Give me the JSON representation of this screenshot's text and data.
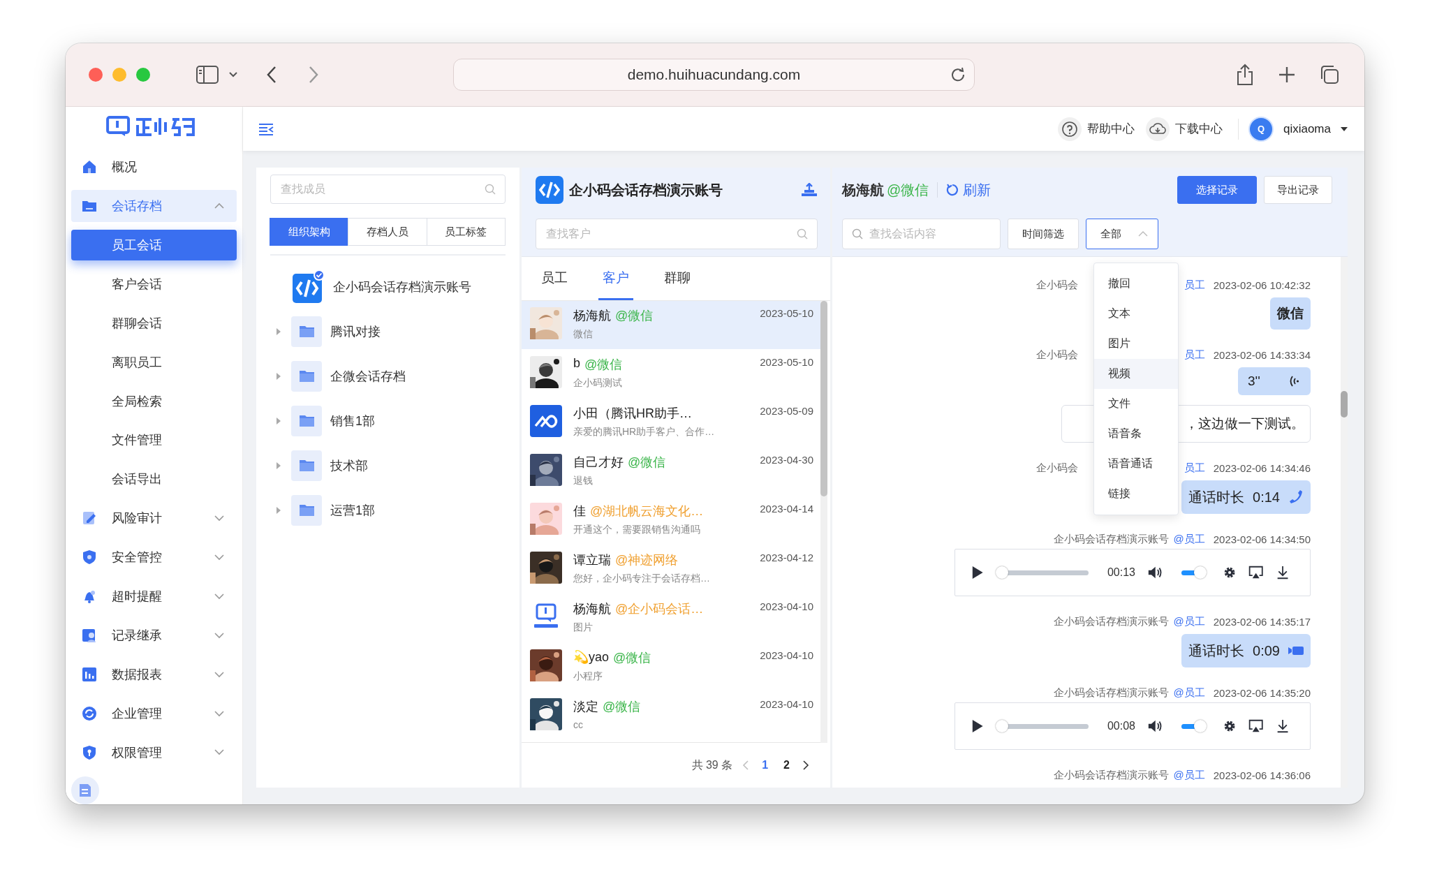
{
  "browser": {
    "url": "demo.huihuacundang.com"
  },
  "sidebar": {
    "items": [
      {
        "label": "概况",
        "kind": "link",
        "selected": false
      },
      {
        "label": "会话存档",
        "kind": "group",
        "expanded": true,
        "selected": true,
        "children": [
          {
            "label": "员工会话",
            "selected": true
          },
          {
            "label": "客户会话",
            "selected": false
          },
          {
            "label": "群聊会话",
            "selected": false
          },
          {
            "label": "离职员工",
            "selected": false
          },
          {
            "label": "全局检索",
            "selected": false
          },
          {
            "label": "文件管理",
            "selected": false
          },
          {
            "label": "会话导出",
            "selected": false
          }
        ]
      },
      {
        "label": "风险审计",
        "kind": "group",
        "expanded": false,
        "selected": false
      },
      {
        "label": "安全管控",
        "kind": "group",
        "expanded": false,
        "selected": false
      },
      {
        "label": "超时提醒",
        "kind": "group",
        "expanded": false,
        "selected": false
      },
      {
        "label": "记录继承",
        "kind": "group",
        "expanded": false,
        "selected": false
      },
      {
        "label": "数据报表",
        "kind": "group",
        "expanded": false,
        "selected": false
      },
      {
        "label": "企业管理",
        "kind": "group",
        "expanded": false,
        "selected": false
      },
      {
        "label": "权限管理",
        "kind": "group",
        "expanded": false,
        "selected": false
      }
    ]
  },
  "header": {
    "help": "帮助中心",
    "download": "下载中心",
    "user": {
      "initial": "Q",
      "name": "qixiaoma"
    }
  },
  "members": {
    "search": {
      "placeholder": "查找成员"
    },
    "tabs": [
      {
        "label": "组织架构",
        "selected": true
      },
      {
        "label": "存档人员",
        "selected": false
      },
      {
        "label": "员工标签",
        "selected": false
      }
    ],
    "tree": [
      {
        "label": "企小码会话存档演示账号",
        "kind": "account"
      },
      {
        "label": "腾讯对接",
        "kind": "folder",
        "expanded": false
      },
      {
        "label": "企微会话存档",
        "kind": "folder",
        "expanded": false
      },
      {
        "label": "销售1部",
        "kind": "folder",
        "expanded": false
      },
      {
        "label": "技术部",
        "kind": "folder",
        "expanded": false
      },
      {
        "label": "运营1部",
        "kind": "folder",
        "expanded": false
      }
    ]
  },
  "customers": {
    "account": "企小码会话存档演示账号",
    "search": {
      "placeholder": "查找客户"
    },
    "tabs": [
      {
        "label": "员工",
        "selected": false
      },
      {
        "label": "客户",
        "selected": true
      },
      {
        "label": "群聊",
        "selected": false
      }
    ],
    "conversations": [
      {
        "name": "杨海航",
        "tag": "@微信",
        "color": "#3bb54a",
        "preview": "微信",
        "date": "2023-05-10",
        "selected": true
      },
      {
        "name": "b",
        "tag": "@微信",
        "color": "#3bb54a",
        "preview": "企小码测试",
        "date": "2023-05-10",
        "selected": false
      },
      {
        "name": "小田（腾讯HR助手…",
        "preview": "亲爱的腾讯HR助手客户、合作…",
        "date": "2023-05-09",
        "selected": false,
        "avatar": {
          "kind": "app-logo"
        }
      },
      {
        "name": "自己才好",
        "tag": "@微信",
        "color": "#3bb54a",
        "preview": "退钱",
        "date": "2023-04-30",
        "selected": false
      },
      {
        "name": "佳",
        "tag": "@湖北帆云海文化…",
        "color": "#f0a030",
        "preview": "开通这个，需要跟销售沟通吗",
        "date": "2023-04-14",
        "selected": false
      },
      {
        "name": "谭立瑞",
        "tag": "@神迹网络",
        "color": "#f0a030",
        "preview": "您好，企小码专注于会话存档…",
        "date": "2023-04-12",
        "selected": false
      },
      {
        "name": "杨海航",
        "tag": "@企小码会话…",
        "color": "#f0a030",
        "preview": "图片",
        "date": "2023-04-10",
        "selected": false,
        "avatar": {
          "kind": "brand-logo"
        }
      },
      {
        "name": "💫yao",
        "tag": "@微信",
        "color": "#3bb54a",
        "preview": "小程序",
        "date": "2023-04-10",
        "selected": false
      },
      {
        "name": "淡定",
        "tag": "@微信",
        "color": "#3bb54a",
        "preview": "cc",
        "date": "2023-04-10",
        "selected": false
      }
    ],
    "pagination": {
      "total": "共 39 条",
      "pages": [
        {
          "label": "1",
          "selected": true
        },
        {
          "label": "2",
          "selected": false
        }
      ]
    }
  },
  "chat": {
    "contact": {
      "name": "杨海航",
      "tag": "@微信"
    },
    "refresh": "刷新",
    "select_button": "选择记录",
    "export_button": "导出记录",
    "search": {
      "placeholder": "查找会话内容"
    },
    "time_filter": "时间筛选",
    "type_filter": {
      "value": "全部",
      "expanded": true,
      "options": [
        {
          "label": "撤回",
          "highlighted": false
        },
        {
          "label": "文本",
          "highlighted": false
        },
        {
          "label": "图片",
          "highlighted": false
        },
        {
          "label": "视频",
          "highlighted": true
        },
        {
          "label": "文件",
          "highlighted": false
        },
        {
          "label": "语音条",
          "highlighted": false
        },
        {
          "label": "语音通话",
          "highlighted": false
        },
        {
          "label": "链接",
          "highlighted": false
        }
      ]
    },
    "messages": [
      {
        "kind": "text",
        "sender": "企小码会",
        "mention": "员工",
        "time": "2023-02-06 10:42:32",
        "covered": true,
        "filled": true,
        "text": "微信"
      },
      {
        "kind": "voice",
        "sender": "企小码会",
        "mention": "员工",
        "time": "2023-02-06 14:33:34",
        "covered": true,
        "duration": "3''"
      },
      {
        "kind": "text",
        "covered": true,
        "filled": false,
        "text": "，这边做一下测试。"
      },
      {
        "kind": "voice-call",
        "sender": "企小码会",
        "mention": "员工",
        "time": "2023-02-06 14:34:46",
        "covered": true,
        "label": "通话时长",
        "duration": "0:14"
      },
      {
        "kind": "audio",
        "sender": "企小码会话存档演示账号",
        "mention": "@员工",
        "time": "2023-02-06 14:34:50",
        "covered": false,
        "elapsed": "00:13",
        "progress": {
          "level": 0
        },
        "volume": {
          "level": 0.8
        }
      },
      {
        "kind": "video-call",
        "sender": "企小码会话存档演示账号",
        "mention": "@员工",
        "time": "2023-02-06 14:35:17",
        "covered": false,
        "label": "通话时长",
        "duration": "0:09"
      },
      {
        "kind": "audio",
        "sender": "企小码会话存档演示账号",
        "mention": "@员工",
        "time": "2023-02-06 14:35:20",
        "covered": false,
        "elapsed": "00:08",
        "progress": {
          "level": 0
        },
        "volume": {
          "level": 0.8
        }
      },
      {
        "kind": "meta",
        "sender": "企小码会话存档演示账号",
        "mention": "@员工",
        "time": "2023-02-06 14:36:06",
        "covered": false
      }
    ]
  }
}
